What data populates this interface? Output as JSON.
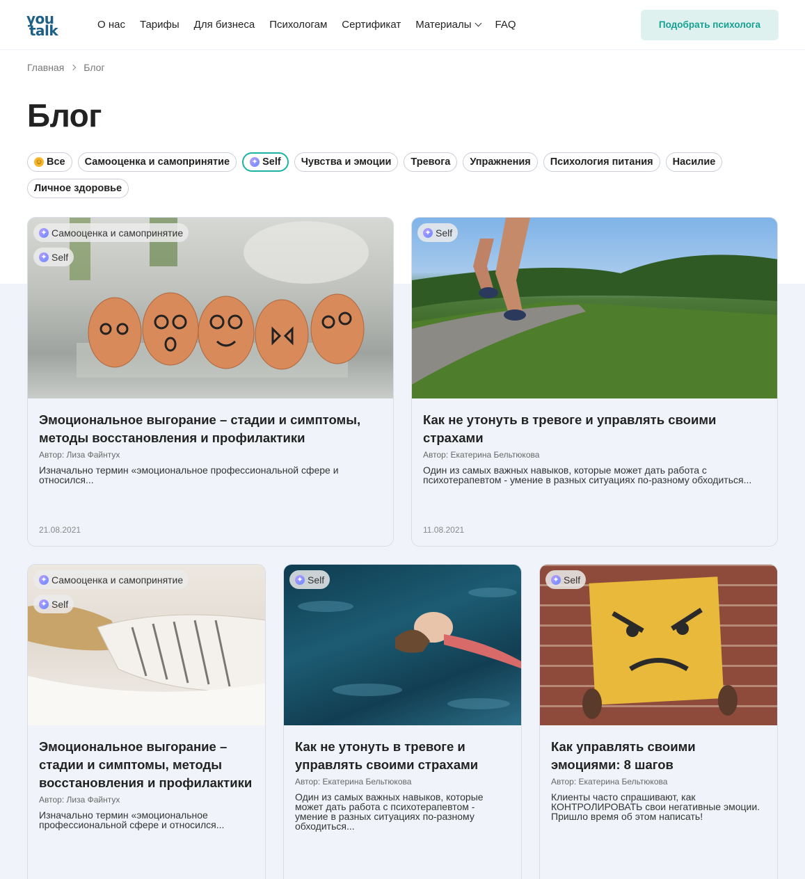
{
  "header": {
    "logo_line1": "you",
    "logo_line2": "talk",
    "nav": [
      "О нас",
      "Тарифы",
      "Для бизнеса",
      "Психологам",
      "Сертификат",
      "Материалы",
      "FAQ"
    ],
    "cta": "Подобрать психолога"
  },
  "breadcrumb": {
    "home": "Главная",
    "current": "Блог"
  },
  "page_title": "Блог",
  "categories": [
    {
      "label": "Все",
      "icon": "smile"
    },
    {
      "label": "Самооценка и самопринятие"
    },
    {
      "label": "Self",
      "icon": "unicorn",
      "active": true
    },
    {
      "label": "Чувства и эмоции"
    },
    {
      "label": "Тревога"
    },
    {
      "label": "Упражнения"
    },
    {
      "label": "Психология питания"
    },
    {
      "label": "Насилие"
    },
    {
      "label": "Личное здоровье"
    }
  ],
  "articles": [
    {
      "tags": [
        "Самооценка и самопринятие",
        "Self"
      ],
      "title": "Эмоциональное выгорание – стадии и симптомы, методы восстановления и профилактики",
      "author": "Автор: Лиза Файнтух",
      "excerpt": "Изначально термин «эмоциональное профессиональной сфере и относился...",
      "date": "21.08.2021"
    },
    {
      "tags": [
        "Self"
      ],
      "title": "Как не утонуть в тревоге и управлять своими страхами",
      "author": "Автор: Екатерина Бельтюкова",
      "excerpt": "Один из самых важных навыков, которые может дать работа с психотерапевтом - умение в разных ситуациях по-разному обходиться...",
      "date": "11.08.2021"
    },
    {
      "tags": [
        "Самооценка и самопринятие",
        "Self"
      ],
      "title": "Эмоциональное выгорание – стадии и симптомы, методы восстановления и профилактики",
      "author": "Автор: Лиза Файнтух",
      "excerpt": "Изначально термин «эмоциональное профессиональной сфере и относился..."
    },
    {
      "tags": [
        "Self"
      ],
      "title": "Как не утонуть в тревоге и управлять своими страхами",
      "author": "Автор: Екатерина Бельтюкова",
      "excerpt": "Один из самых важных навыков, которые может дать работа с психотерапевтом - умение в разных ситуациях по-разному обходиться..."
    },
    {
      "tags": [
        "Self"
      ],
      "title": "Как управлять своими эмоциями: 8 шагов",
      "author": "Автор: Екатерина Бельтюкова",
      "excerpt": "Клиенты часто спрашивают, как КОНТРОЛИРОВАТЬ свои негативные эмоции. Пришло время об этом написать!"
    }
  ]
}
